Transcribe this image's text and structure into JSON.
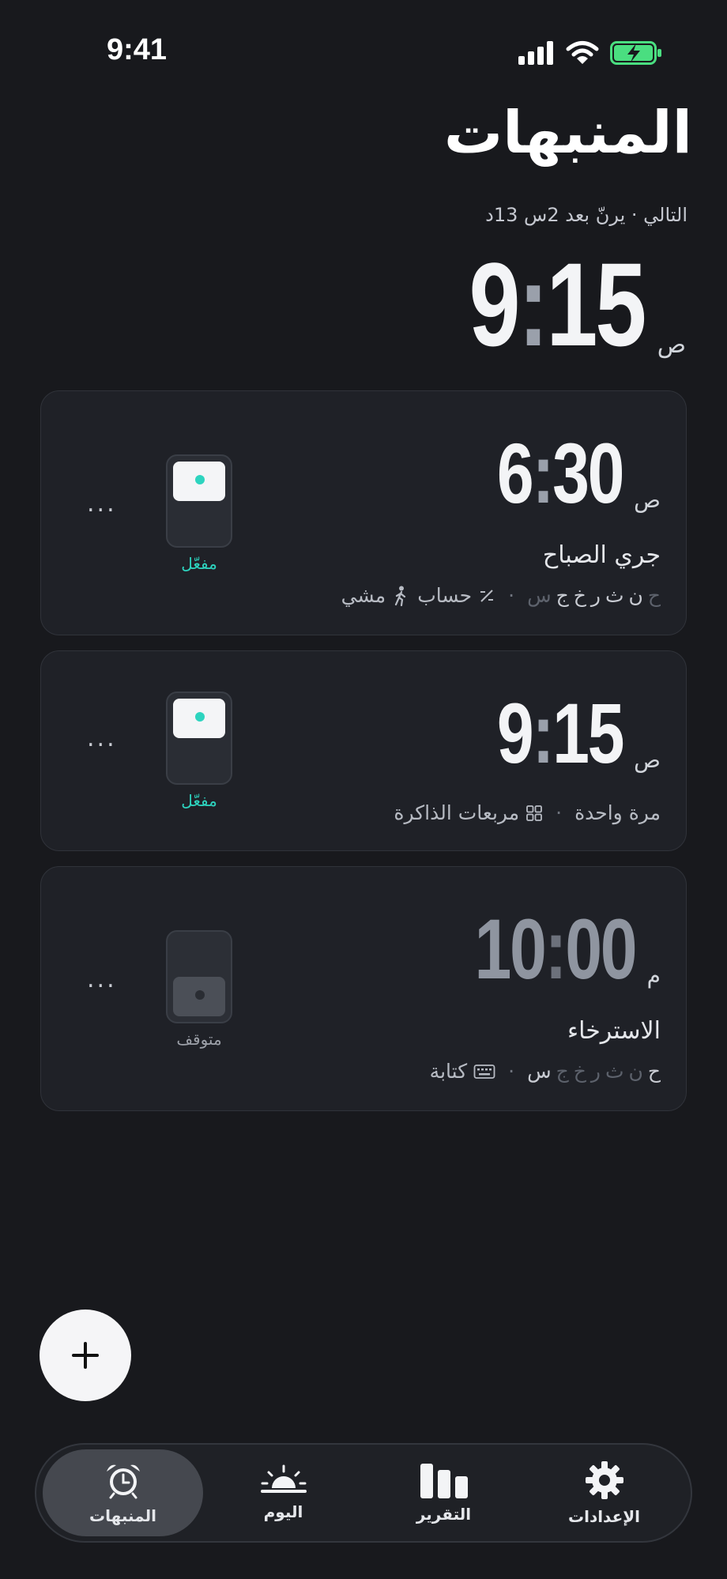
{
  "status_bar": {
    "time": "9:41"
  },
  "header": {
    "title": "المنبهات",
    "next_alarm_text": "التالي · يرنّ بعد 2س 13د",
    "next_time_hour": "9",
    "next_time_minute": "15",
    "next_time_suffix": "ص"
  },
  "alarms": [
    {
      "hour": "6",
      "minute": "30",
      "suffix": "ص",
      "name": "جري الصباح",
      "days": [
        "ح",
        "ن",
        "ث",
        "ر",
        "خ",
        "ج",
        "س"
      ],
      "days_active": [
        false,
        true,
        true,
        true,
        true,
        true,
        false
      ],
      "challenges": [
        "حساب",
        "مشي"
      ],
      "status": "مفعّل"
    },
    {
      "hour": "9",
      "minute": "15",
      "suffix": "ص",
      "repeat": "مرة واحدة",
      "challenges": [
        "مربعات الذاكرة"
      ],
      "status": "مفعّل"
    },
    {
      "hour": "10",
      "minute": "00",
      "suffix": "م",
      "name": "الاسترخاء",
      "days": [
        "ح",
        "ن",
        "ث",
        "ر",
        "خ",
        "ج",
        "س"
      ],
      "days_active": [
        true,
        false,
        false,
        false,
        false,
        false,
        true
      ],
      "challenges": [
        "كتابة"
      ],
      "status": "متوقف"
    }
  ],
  "more_label": "...",
  "tabs": [
    {
      "label": "المنبهات",
      "icon": "alarm-clock-icon",
      "active": true
    },
    {
      "label": "اليوم",
      "icon": "sunrise-icon",
      "active": false
    },
    {
      "label": "التقرير",
      "icon": "bar-chart-icon",
      "active": false
    },
    {
      "label": "الإعدادات",
      "icon": "gear-icon",
      "active": false
    }
  ],
  "colors": {
    "accent": "#2dd4bf",
    "background": "#18191d",
    "card": "#1f2127"
  }
}
